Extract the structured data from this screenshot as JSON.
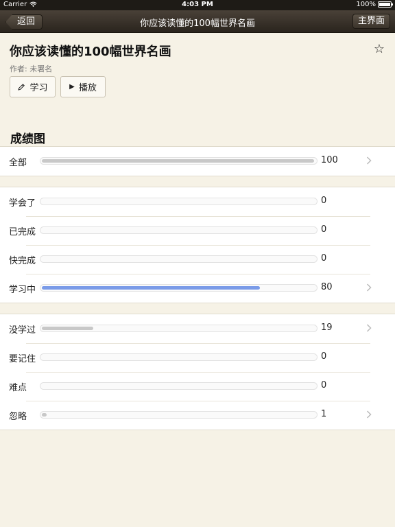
{
  "statusbar": {
    "carrier": "Carrier",
    "time": "4:03 PM",
    "battery": "100%"
  },
  "navbar": {
    "back_label": "返回",
    "title": "你应该读懂的100幅世界名画",
    "home_label": "主界面"
  },
  "book": {
    "title": "你应该读懂的100幅世界名画",
    "author": "作者: 未署名"
  },
  "actions": {
    "study_label": "学习",
    "play_label": "播放"
  },
  "section": {
    "title": "成绩图"
  },
  "icons": {
    "star": "star-outline-icon",
    "pencil": "pencil-icon",
    "play": "play-icon",
    "chevron": "chevron-right-icon"
  },
  "colors": {
    "accent_bar": "#7a9be8",
    "neutral_bar": "#c8c8c8",
    "background": "#f6f2e6"
  },
  "groups": [
    {
      "rows": [
        {
          "label": "全部",
          "value": 100,
          "fraction": 1.0,
          "blue": false,
          "chevron": true
        }
      ]
    },
    {
      "rows": [
        {
          "label": "学会了",
          "value": 0,
          "fraction": 0,
          "blue": false,
          "chevron": false
        },
        {
          "label": "已完成",
          "value": 0,
          "fraction": 0,
          "blue": false,
          "chevron": false
        },
        {
          "label": "快完成",
          "value": 0,
          "fraction": 0,
          "blue": false,
          "chevron": false
        },
        {
          "label": "学习中",
          "value": 80,
          "fraction": 0.8,
          "blue": true,
          "chevron": true
        }
      ]
    },
    {
      "rows": [
        {
          "label": "没学过",
          "value": 19,
          "fraction": 0.19,
          "blue": false,
          "chevron": true
        },
        {
          "label": "要记住",
          "value": 0,
          "fraction": 0,
          "blue": false,
          "chevron": false
        },
        {
          "label": "难点",
          "value": 0,
          "fraction": 0,
          "blue": false,
          "chevron": false
        },
        {
          "label": "忽略",
          "value": 1,
          "fraction": 0.01,
          "blue": false,
          "chevron": true
        }
      ]
    }
  ]
}
